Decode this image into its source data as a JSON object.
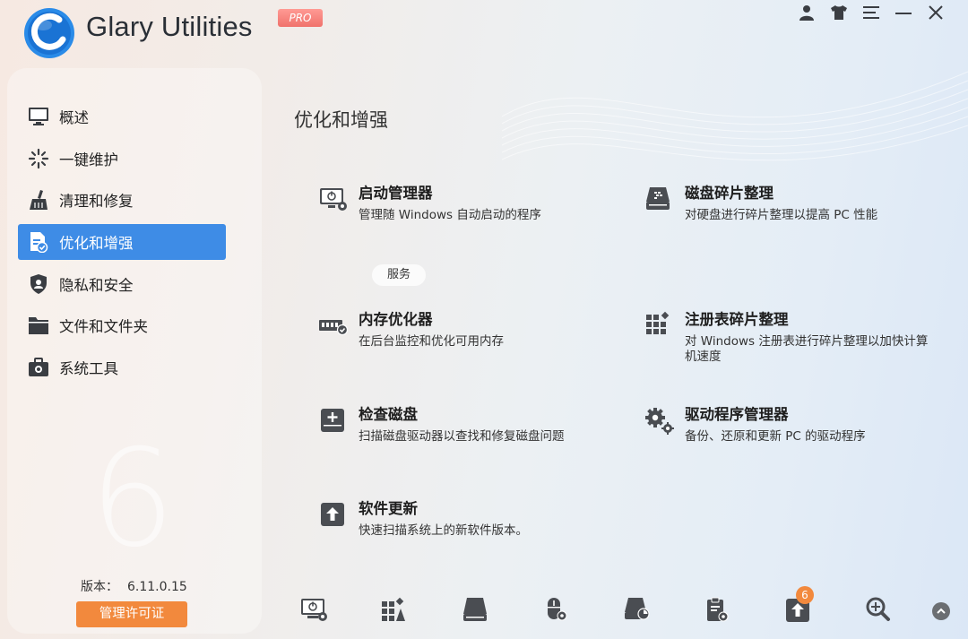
{
  "app": {
    "title": "Glary Utilities",
    "edition": "PRO",
    "version_label": "版本：",
    "version_number": "6.11.0.15",
    "license_button": "管理许可证",
    "watermark": "6",
    "accent": "#3e8ce6",
    "orange": "#f2893d"
  },
  "sidebar": {
    "items": [
      {
        "label": "概述",
        "icon": "monitor-icon",
        "active": false
      },
      {
        "label": "一键维护",
        "icon": "sparkle-icon",
        "active": false
      },
      {
        "label": "清理和修复",
        "icon": "broom-icon",
        "active": false
      },
      {
        "label": "优化和增强",
        "icon": "optimize-icon",
        "active": true
      },
      {
        "label": "隐私和安全",
        "icon": "shield-icon",
        "active": false
      },
      {
        "label": "文件和文件夹",
        "icon": "folder-icon",
        "active": false
      },
      {
        "label": "系统工具",
        "icon": "toolbox-icon",
        "active": false
      }
    ]
  },
  "main": {
    "title": "优化和增强",
    "services_tag": "服务",
    "tools": [
      {
        "name": "启动管理器",
        "desc": "管理随 Windows 自动启动的程序",
        "icon": "startup-manager-icon"
      },
      {
        "name": "磁盘碎片整理",
        "desc": "对硬盘进行碎片整理以提高 PC 性能",
        "icon": "disk-defrag-icon"
      },
      {
        "name": "内存优化器",
        "desc": "在后台监控和优化可用内存",
        "icon": "memory-optimizer-icon"
      },
      {
        "name": "注册表碎片整理",
        "desc": "对 Windows 注册表进行碎片整理以加快计算机速度",
        "icon": "registry-defrag-icon"
      },
      {
        "name": "检查磁盘",
        "desc": "扫描磁盘驱动器以查找和修复磁盘问题",
        "icon": "check-disk-icon"
      },
      {
        "name": "驱动程序管理器",
        "desc": "备份、还原和更新 PC 的驱动程序",
        "icon": "driver-manager-icon"
      },
      {
        "name": "软件更新",
        "desc": "快速扫描系统上的新软件版本。",
        "icon": "software-update-icon"
      }
    ]
  },
  "bottom_bar": {
    "update_badge": "6",
    "icons": [
      "startup-icon",
      "registry-icon",
      "disk-icon",
      "mouse-icon",
      "disk-analysis-icon",
      "clipboard-icon",
      "upload-icon",
      "search-icon"
    ]
  },
  "window_controls": [
    "user-icon",
    "skin-icon",
    "menu-icon",
    "minimize-icon",
    "close-icon"
  ]
}
